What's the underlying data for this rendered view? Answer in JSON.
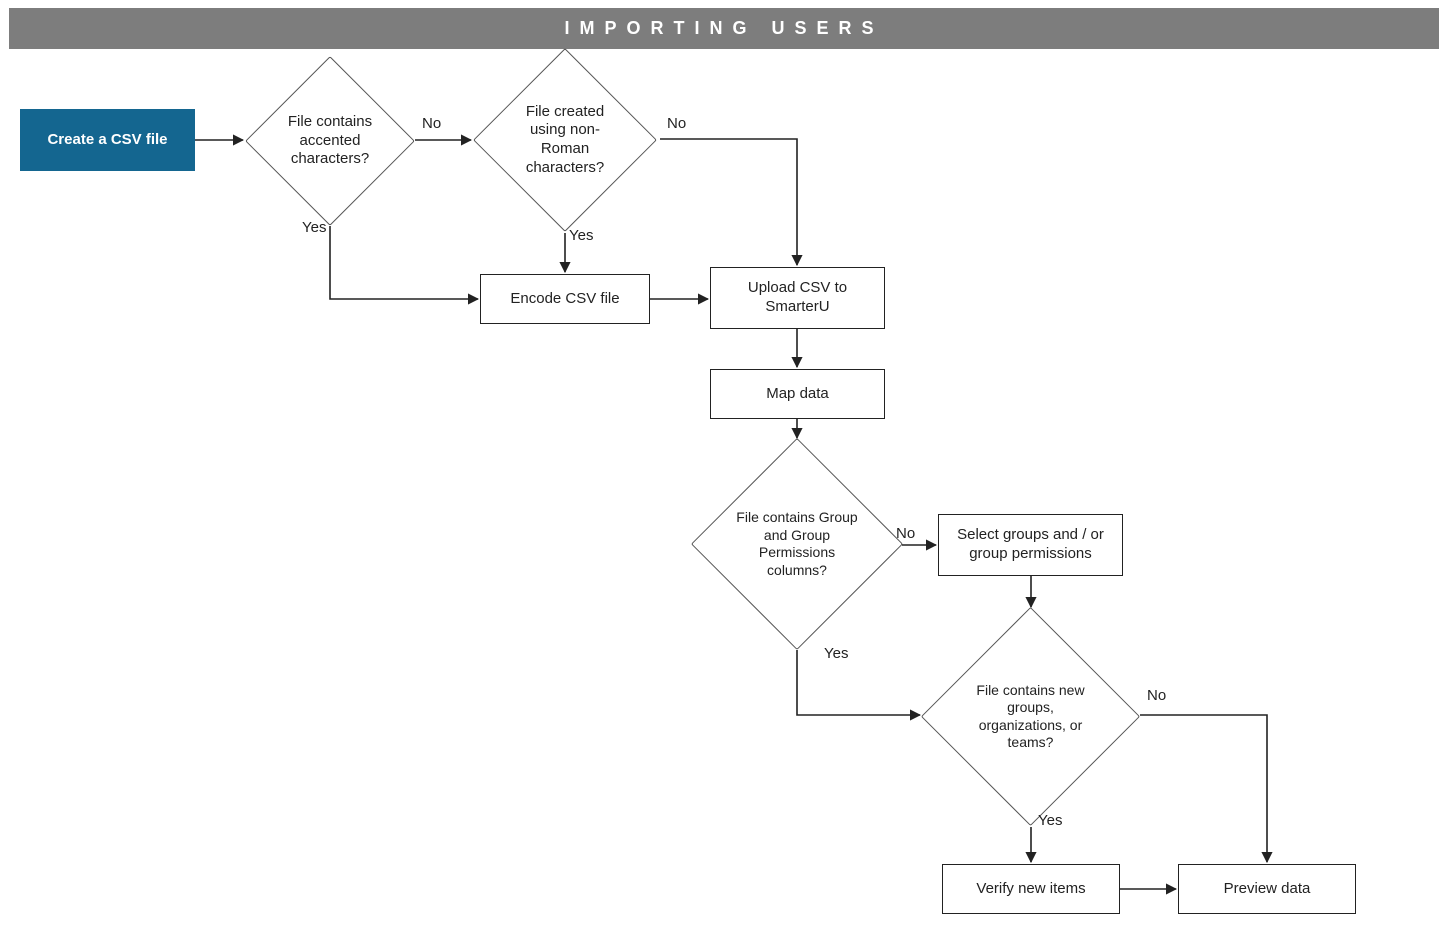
{
  "header": {
    "title": "IMPORTING USERS"
  },
  "nodes": {
    "start": "Create a CSV file",
    "d_accented": "File contains accented characters?",
    "d_nonroman": "File created using non-Roman characters?",
    "encode": "Encode CSV file",
    "upload": "Upload CSV to SmarterU",
    "map": "Map data",
    "d_groupcols": "File contains Group and Group Permissions columns?",
    "select_groups": "Select groups and / or group permissions",
    "d_newgroups": "File contains new groups, organizations, or teams?",
    "verify": "Verify new items",
    "preview": "Preview data"
  },
  "labels": {
    "yes": "Yes",
    "no": "No"
  },
  "colors": {
    "header_bg": "#7d7d7d",
    "start_bg": "#146690"
  }
}
